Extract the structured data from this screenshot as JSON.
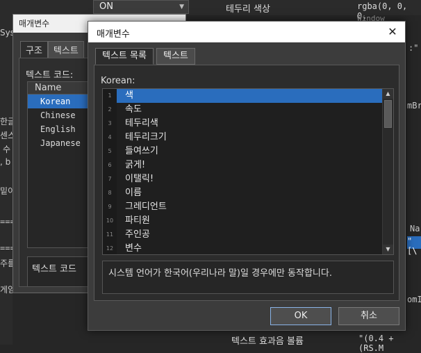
{
  "background": {
    "dropdown_value": "ON",
    "property_label": "테두리 색상",
    "property_value": "rgba(0, 0, 0,",
    "property_sub": "Window",
    "bottom_label": "텍스트 효과음 볼륨",
    "bottom_value": "\"(0.4 + (RS.M",
    "left_fragments": [
      "Sys",
      "한글",
      "센스",
      "수",
      ", b",
      "밑이",
      "===",
      "===",
      "주를",
      "게임"
    ],
    "right_fragments": [
      ":\"",
      "mBr",
      "Na",
      "\"[\\",
      "omI"
    ]
  },
  "back_dialog": {
    "title": "매개변수",
    "tabs": [
      "구조",
      "텍스트"
    ],
    "code_label": "텍스트 코드:",
    "column_header": "Name",
    "items": [
      "Korean",
      "Chinese",
      "English",
      "Japanese"
    ],
    "selected_index": 0,
    "bottom_label": "텍스트 코드"
  },
  "dialog": {
    "title": "매개변수",
    "tabs": [
      {
        "label": "텍스트 목록",
        "active": true
      },
      {
        "label": "텍스트",
        "active": false
      }
    ],
    "group_label": "Korean:",
    "items": [
      {
        "num": "1",
        "text": "색"
      },
      {
        "num": "2",
        "text": "속도"
      },
      {
        "num": "3",
        "text": "테두리색"
      },
      {
        "num": "4",
        "text": "테두리크기"
      },
      {
        "num": "5",
        "text": "들여쓰기"
      },
      {
        "num": "6",
        "text": "굵게!"
      },
      {
        "num": "7",
        "text": "이탤릭!"
      },
      {
        "num": "8",
        "text": "이름"
      },
      {
        "num": "9",
        "text": "그레디언트"
      },
      {
        "num": "10",
        "text": "파티원"
      },
      {
        "num": "11",
        "text": "주인공"
      },
      {
        "num": "12",
        "text": "변수"
      }
    ],
    "selected_index": 0,
    "description": "시스템 언어가 한국어(우리나라 말)일 경우에만 동작합니다.",
    "ok_label": "OK",
    "cancel_label": "취소",
    "close_symbol": "✕",
    "scroll_up": "▲",
    "scroll_down": "▼",
    "accent_color": "#2a6dbd"
  }
}
